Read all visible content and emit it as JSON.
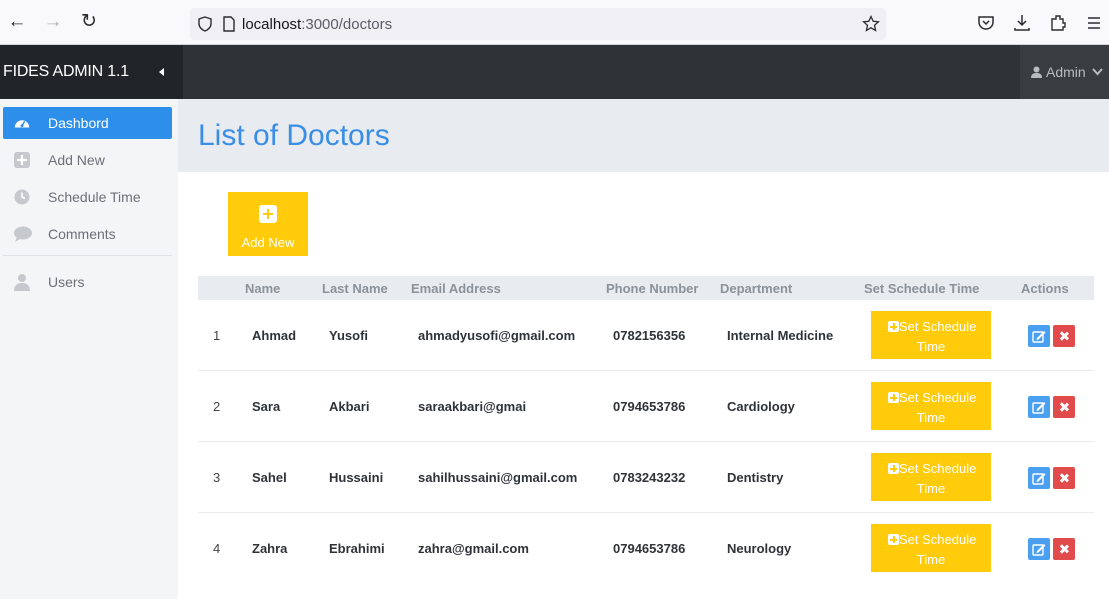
{
  "browser": {
    "url_host": "localhost",
    "url_path": ":3000/doctors"
  },
  "header": {
    "brand": "FIDES ADMIN 1.1",
    "user_label": "Admin"
  },
  "sidebar": {
    "items": [
      {
        "label": "Dashbord",
        "icon": "dashboard-icon",
        "active": true
      },
      {
        "label": "Add New",
        "icon": "plus-square-icon",
        "active": false
      },
      {
        "label": "Schedule Time",
        "icon": "clock-icon",
        "active": false
      },
      {
        "label": "Comments",
        "icon": "comment-icon",
        "active": false
      },
      {
        "label": "Users",
        "icon": "user-icon",
        "active": false
      }
    ]
  },
  "main": {
    "title": "List of Doctors",
    "add_button": "Add New",
    "columns": [
      "Name",
      "Last Name",
      "Email Address",
      "Phone Number",
      "Department",
      "Set Schedule Time",
      "Actions"
    ],
    "schedule_button_line1": "Set Schedule",
    "schedule_button_line2": "Time",
    "rows": [
      {
        "num": "1",
        "name": "Ahmad",
        "last": "Yusofi",
        "email": "ahmadyusofi@gmail.com",
        "phone": "0782156356",
        "dept": "Internal Medicine"
      },
      {
        "num": "2",
        "name": "Sara",
        "last": "Akbari",
        "email": "saraakbari@gmai",
        "phone": "0794653786",
        "dept": "Cardiology"
      },
      {
        "num": "3",
        "name": "Sahel",
        "last": "Hussaini",
        "email": "sahilhussaini@gmail.com",
        "phone": "0783243232",
        "dept": "Dentistry"
      },
      {
        "num": "4",
        "name": "Zahra",
        "last": "Ebrahimi",
        "email": "zahra@gmail.com",
        "phone": "0794653786",
        "dept": "Neurology"
      }
    ]
  },
  "colors": {
    "accent": "#2e8fea",
    "title": "#3a8ee6",
    "button_yellow": "#ffcb0a",
    "edit_blue": "#4a9ff0",
    "delete_red": "#e14b4b",
    "header_dark": "#2f3237"
  }
}
